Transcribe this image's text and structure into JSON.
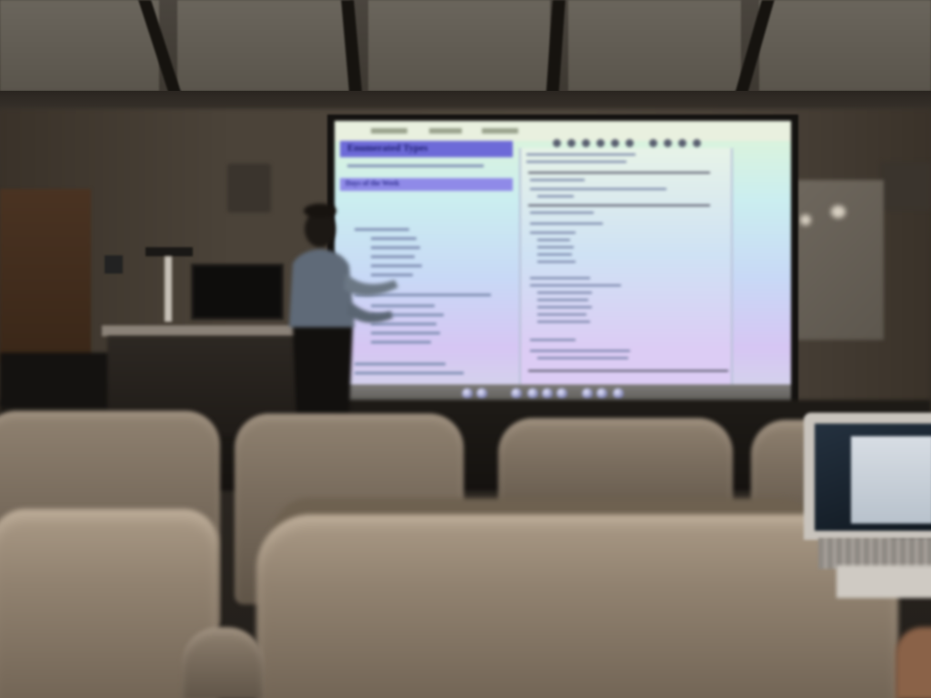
{
  "scene": {
    "description_tag": "lecture-hall-projection",
    "palette": {
      "wall": "#4b4339",
      "screen_top": "#dff5d8",
      "screen_bottom": "#d6c6f3",
      "slide_title_bar": "#6d6ad8",
      "seat": "#918270"
    }
  },
  "slide": {
    "title": "Enumerated Types",
    "subtitle": "Days of the Week"
  },
  "icons": {
    "dock": "application-dock-icons",
    "toolbar": "editor-toolbar-icons"
  }
}
